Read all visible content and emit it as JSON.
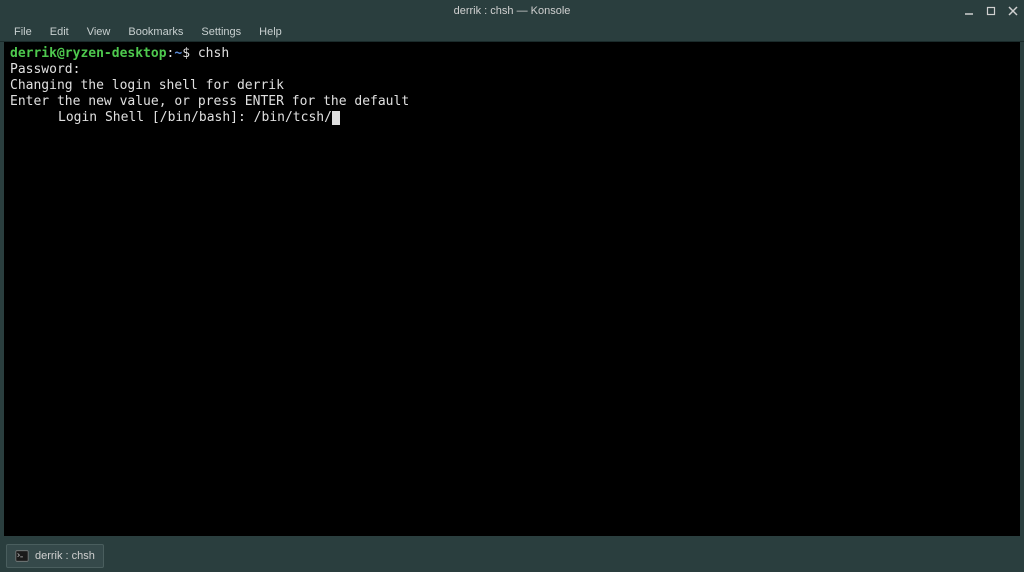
{
  "window": {
    "title": "derrik : chsh — Konsole"
  },
  "menubar": {
    "items": [
      {
        "label": "File"
      },
      {
        "label": "Edit"
      },
      {
        "label": "View"
      },
      {
        "label": "Bookmarks"
      },
      {
        "label": "Settings"
      },
      {
        "label": "Help"
      }
    ]
  },
  "terminal": {
    "prompt": {
      "user_host": "derrik@ryzen-desktop",
      "sep": ":",
      "path": "~",
      "dollar": "$"
    },
    "command": " chsh",
    "lines": {
      "password": "Password:",
      "changing": "Changing the login shell for derrik",
      "enter_new": "Enter the new value, or press ENTER for the default",
      "login_shell_prompt": "Login Shell [/bin/bash]: ",
      "login_shell_input": "/bin/tcsh/"
    }
  },
  "taskbar": {
    "item_label": "derrik : chsh"
  }
}
